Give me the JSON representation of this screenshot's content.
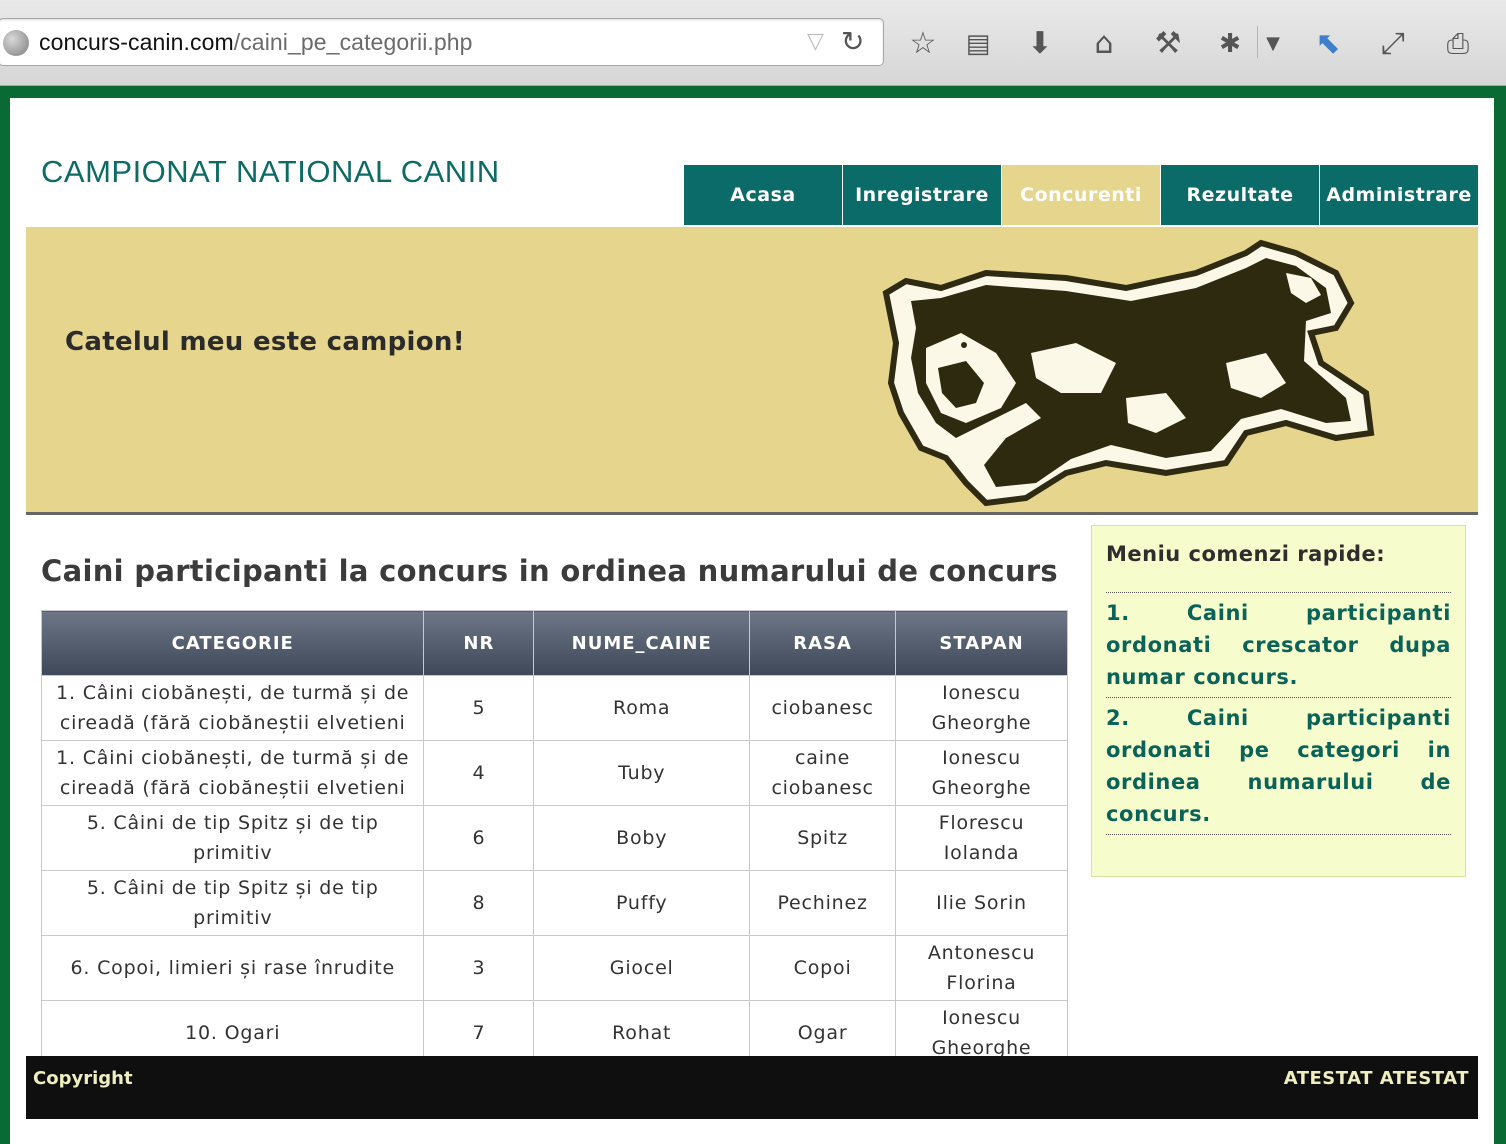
{
  "browser": {
    "url_domain": "concurs-canin.com",
    "url_path": "/caini_pe_categorii.php"
  },
  "site": {
    "title": "CAMPIONAT NATIONAL CANIN",
    "slogan": "Catelul meu este campion!"
  },
  "nav": {
    "items": [
      {
        "label": "Acasa",
        "active": false
      },
      {
        "label": "Inregistrare",
        "active": false
      },
      {
        "label": "Concurenti",
        "active": true
      },
      {
        "label": "Rezultate",
        "active": false
      },
      {
        "label": "Administrare",
        "active": false
      }
    ]
  },
  "main": {
    "heading": "Caini participanti la concurs in ordinea numarului de concurs",
    "table": {
      "headers": [
        "CATEGORIE",
        "NR",
        "NUME_CAINE",
        "RASA",
        "STAPAN"
      ],
      "rows": [
        [
          "1. Câini ciobănești, de turmă și de cireadă (fără ciobăneștii elvetieni",
          "5",
          "Roma",
          "ciobanesc",
          "Ionescu Gheorghe"
        ],
        [
          "1. Câini ciobănești, de turmă și de cireadă (fără ciobăneștii elvetieni",
          "4",
          "Tuby",
          "caine ciobanesc",
          "Ionescu Gheorghe"
        ],
        [
          "5. Câini de tip Spitz și de tip primitiv",
          "6",
          "Boby",
          "Spitz",
          "Florescu Iolanda"
        ],
        [
          "5. Câini de tip Spitz și de tip primitiv",
          "8",
          "Puffy",
          "Pechinez",
          "Ilie Sorin"
        ],
        [
          "6. Copoi, limieri și rase înrudite",
          "3",
          "Giocel",
          "Copoi",
          "Antonescu Florina"
        ],
        [
          "10. Ogari",
          "7",
          "Rohat",
          "Ogar",
          "Ionescu Gheorghe"
        ]
      ]
    }
  },
  "sidebar": {
    "title": "Meniu comenzi rapide:",
    "links": [
      "1. Caini participanti ordonati crescator dupa numar concurs.",
      "2. Caini participanti ordonati pe categori in ordinea numarului de concurs."
    ]
  },
  "footer": {
    "left": "Copyright",
    "right": "ATESTAT ATESTAT"
  },
  "colors": {
    "nav_bg": "#0a6b68",
    "nav_active": "#e6d58c",
    "banner_bg": "#e6d58c",
    "sidebar_bg": "#f7fccc",
    "frame_green": "#0a6a33"
  }
}
